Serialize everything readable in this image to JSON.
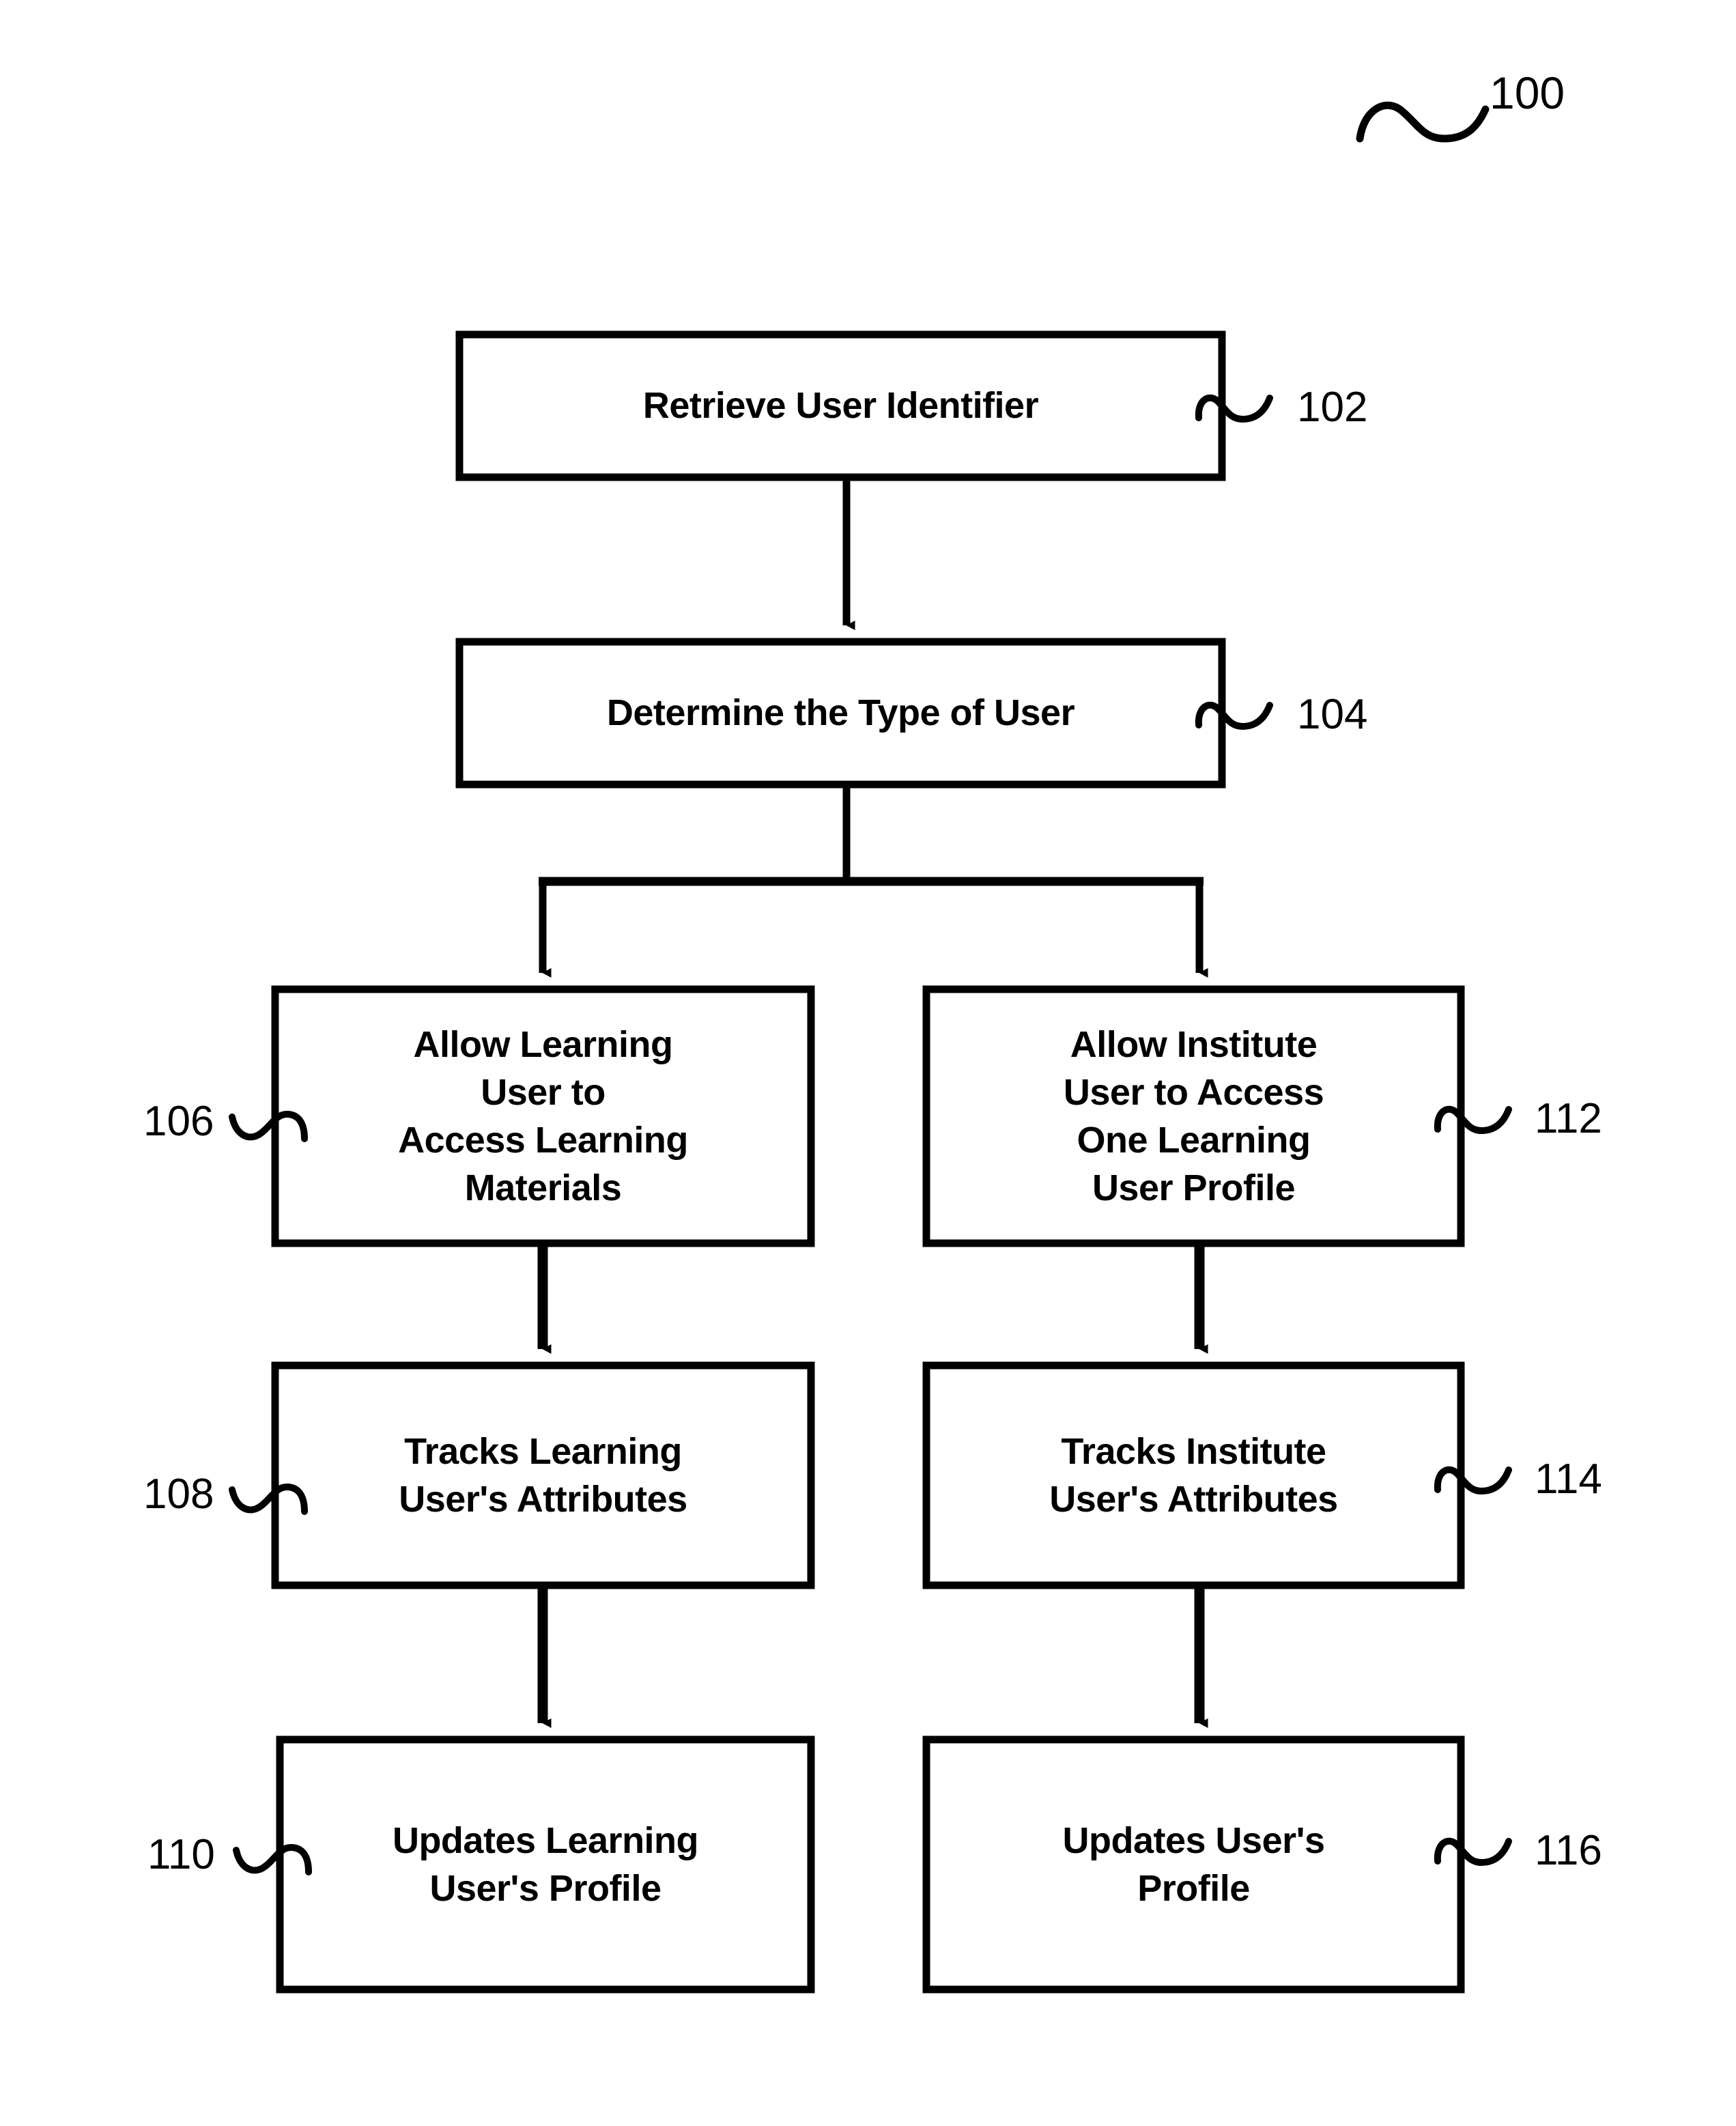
{
  "figure": {
    "number": "100",
    "type": "patent-flowchart"
  },
  "nodes": [
    {
      "id": "step-102",
      "ref": "102",
      "text": "Retrieve User Identifier",
      "ref_side": "right"
    },
    {
      "id": "step-104",
      "ref": "104",
      "text": "Determine the Type of User",
      "ref_side": "right"
    },
    {
      "id": "step-106",
      "ref": "106",
      "text": "Allow Learning\nUser to\nAccess Learning\nMaterials",
      "ref_side": "left"
    },
    {
      "id": "step-108",
      "ref": "108",
      "text": "Tracks Learning\nUser's Attributes",
      "ref_side": "left"
    },
    {
      "id": "step-110",
      "ref": "110",
      "text": "Updates Learning\nUser's Profile",
      "ref_side": "left"
    },
    {
      "id": "step-112",
      "ref": "112",
      "text": "Allow Institute\nUser to Access\nOne Learning\nUser Profile",
      "ref_side": "right"
    },
    {
      "id": "step-114",
      "ref": "114",
      "text": "Tracks Institute\nUser's Attributes",
      "ref_side": "right"
    },
    {
      "id": "step-116",
      "ref": "116",
      "text": "Updates User's\nProfile",
      "ref_side": "right"
    }
  ],
  "edges": [
    {
      "id": "edge-102-104",
      "from": "step-102",
      "to": "step-104",
      "kind": "arrow-down"
    },
    {
      "id": "edge-104-split",
      "from": "step-104",
      "to": "split-bar",
      "kind": "line-down"
    },
    {
      "id": "edge-split-106",
      "from": "split-bar",
      "to": "step-106",
      "kind": "arrow-down"
    },
    {
      "id": "edge-split-112",
      "from": "split-bar",
      "to": "step-112",
      "kind": "arrow-down"
    },
    {
      "id": "edge-106-108",
      "from": "step-106",
      "to": "step-108",
      "kind": "arrow-down"
    },
    {
      "id": "edge-108-110",
      "from": "step-108",
      "to": "step-110",
      "kind": "arrow-down"
    },
    {
      "id": "edge-112-114",
      "from": "step-112",
      "to": "step-114",
      "kind": "arrow-down"
    },
    {
      "id": "edge-114-116",
      "from": "step-114",
      "to": "step-116",
      "kind": "arrow-down"
    }
  ],
  "style": {
    "stroke": "#000000",
    "fill": "#ffffff",
    "background": "#ffffff"
  }
}
